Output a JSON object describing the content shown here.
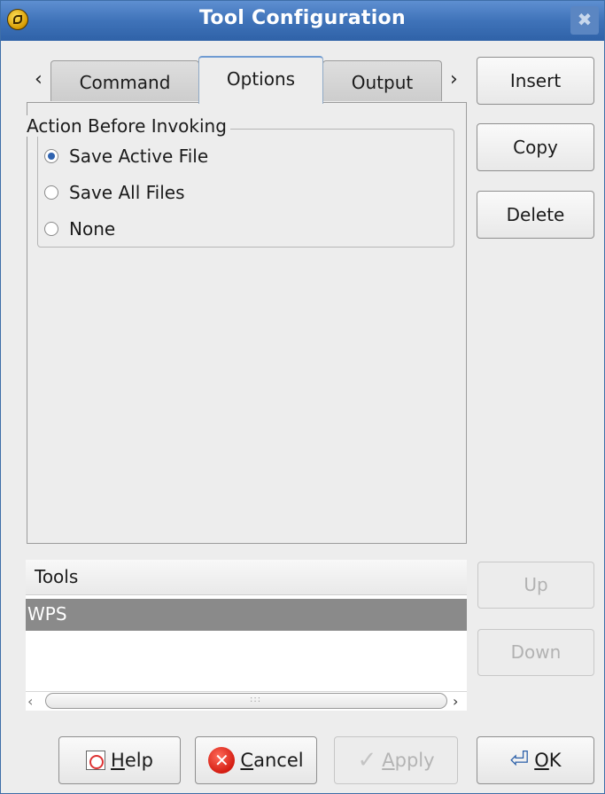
{
  "window": {
    "title": "Tool Configuration",
    "close_symbol": "✖",
    "accent": "#3f73b9"
  },
  "tabs": {
    "left_arrow": "‹",
    "right_arrow": "›",
    "items": [
      {
        "label": "Command",
        "active": false
      },
      {
        "label": "Options",
        "active": true
      },
      {
        "label": "Output",
        "active": false
      }
    ]
  },
  "options": {
    "group_title": "Action Before Invoking",
    "radios": [
      {
        "label": "Save Active File",
        "checked": true
      },
      {
        "label": "Save All Files",
        "checked": false
      },
      {
        "label": "None",
        "checked": false
      }
    ]
  },
  "side_buttons": {
    "insert": "Insert",
    "copy": "Copy",
    "delete": "Delete",
    "up": "Up",
    "down": "Down"
  },
  "tools": {
    "header": "Tools",
    "rows": [
      "WPS"
    ],
    "selected_row": "WPS"
  },
  "footer": {
    "help_mnemonic": "H",
    "help_rest": "elp",
    "cancel_mnemonic": "C",
    "cancel_rest": "ancel",
    "apply_mnemonic": "A",
    "apply_rest": "pply",
    "ok_mnemonic": "O",
    "ok_rest": "K"
  }
}
